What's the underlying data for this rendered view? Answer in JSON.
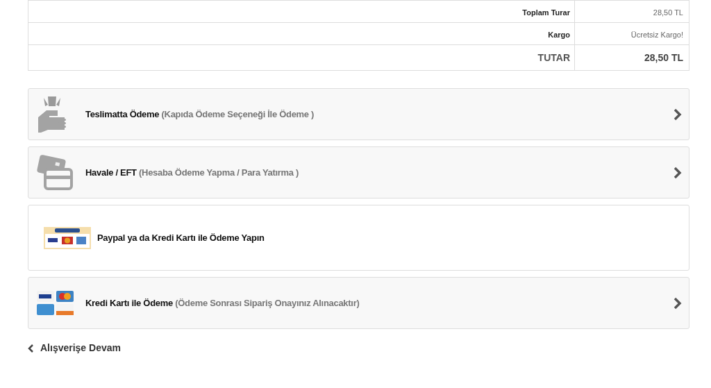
{
  "summary": [
    {
      "label": "Toplam Turar",
      "value": "28,50 TL",
      "kind": "normal"
    },
    {
      "label": "Kargo",
      "value": "Ücretsiz Kargo!",
      "kind": "normal"
    },
    {
      "label": "TUTAR",
      "value": "28,50 TL",
      "kind": "total"
    }
  ],
  "payment_options": [
    {
      "kind": "cash",
      "title": "Teslimatta Ödeme",
      "note": "(Kapıda Ödeme Seçeneği İle Ödeme )",
      "selected": false
    },
    {
      "kind": "transfer",
      "title": "Havale / EFT",
      "note": "(Hesaba Ödeme Yapma / Para Yatırma )",
      "selected": false
    },
    {
      "kind": "paypal",
      "title": "Paypal ya da Kredi Kartı ile Ödeme Yapın",
      "selected": true
    },
    {
      "kind": "card",
      "title": "Kredi Kartı ile Ödeme",
      "note": "(Ödeme Sonrası Sipariş Onayınız Alınacaktır)",
      "selected": false
    }
  ],
  "back_link": "Alışverişe Devam"
}
